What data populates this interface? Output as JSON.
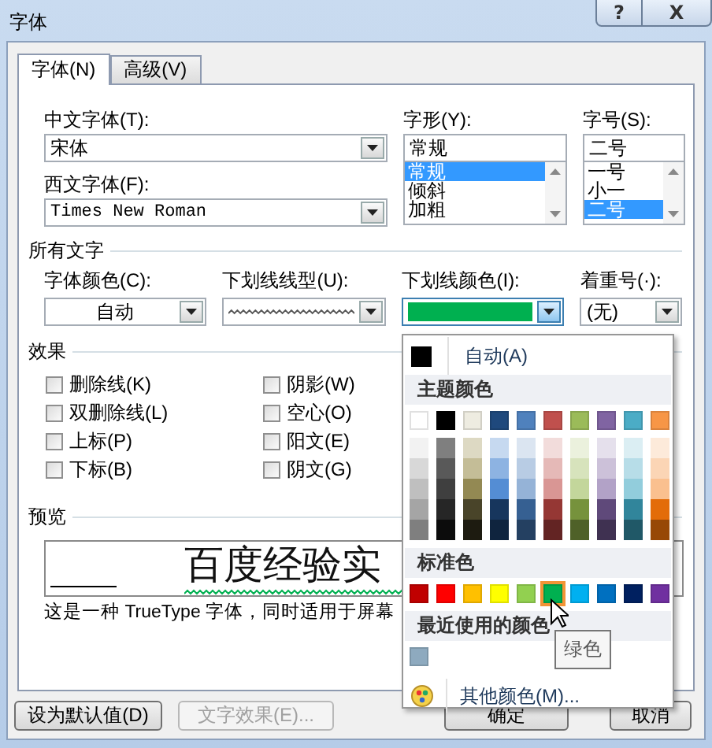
{
  "window": {
    "title": "字体",
    "help": "?",
    "close": "X"
  },
  "tabs": [
    {
      "label": "字体(N)",
      "selected": true
    },
    {
      "label": "高级(V)",
      "selected": false
    }
  ],
  "font": {
    "chinese_font": {
      "label": "中文字体(T):",
      "value": "宋体"
    },
    "western_font": {
      "label": "西文字体(F):",
      "value": "Times New Roman"
    },
    "style": {
      "label": "字形(Y):",
      "value": "常规",
      "items": [
        {
          "label": "常规",
          "selected": true
        },
        {
          "label": "倾斜",
          "selected": false
        },
        {
          "label": "加粗",
          "selected": false
        }
      ]
    },
    "size": {
      "label": "字号(S):",
      "value": "二号",
      "items": [
        {
          "label": "一号",
          "selected": false
        },
        {
          "label": "小一",
          "selected": false
        },
        {
          "label": "二号",
          "selected": true
        }
      ]
    }
  },
  "all_text": {
    "heading": "所有文字",
    "font_color": {
      "label": "字体颜色(C):",
      "value": "自动"
    },
    "underline_style": {
      "label": "下划线线型(U):"
    },
    "underline_color": {
      "label": "下划线颜色(I):",
      "color": "#00b050",
      "open": true
    },
    "emphasis": {
      "label": "着重号(·):",
      "value": "(无)"
    }
  },
  "effects": {
    "heading": "效果",
    "options": [
      {
        "label": "删除线(K)",
        "checked": false
      },
      {
        "label": "阴影(W)",
        "checked": false
      },
      {
        "label": "双删除线(L)",
        "checked": false
      },
      {
        "label": "空心(O)",
        "checked": false
      },
      {
        "label": "上标(P)",
        "checked": false
      },
      {
        "label": "阳文(E)",
        "checked": false
      },
      {
        "label": "下标(B)",
        "checked": false
      },
      {
        "label": "阴文(G)",
        "checked": false
      }
    ]
  },
  "preview": {
    "heading": "预览",
    "sample": "百度经验实",
    "description": "这是一种 TrueType 字体，同时适用于屏幕"
  },
  "buttons": [
    {
      "label": "设为默认值(D)",
      "disabled": false
    },
    {
      "label": "文字效果(E)...",
      "disabled": true
    },
    {
      "label": "确定",
      "disabled": false
    },
    {
      "label": "取消",
      "disabled": false
    }
  ],
  "color_menu": {
    "automatic": {
      "label": "自动(A)",
      "color": "#000000"
    },
    "theme_heading": "主题颜色",
    "theme_colors": [
      {
        "color": "#ffffff",
        "selected": false,
        "shades": [
          {
            "color": "#f2f2f2"
          },
          {
            "color": "#d8d8d8"
          },
          {
            "color": "#bfbfbf"
          },
          {
            "color": "#a5a5a5"
          },
          {
            "color": "#7f7f7f"
          }
        ]
      },
      {
        "color": "#000000",
        "selected": false,
        "shades": [
          {
            "color": "#7f7f7f"
          },
          {
            "color": "#595959"
          },
          {
            "color": "#3f3f3f"
          },
          {
            "color": "#262626"
          },
          {
            "color": "#0c0c0c"
          }
        ]
      },
      {
        "color": "#eeece1",
        "selected": false,
        "shades": [
          {
            "color": "#ddd9c3"
          },
          {
            "color": "#c4bd97"
          },
          {
            "color": "#938953"
          },
          {
            "color": "#494429"
          },
          {
            "color": "#1d1b10"
          }
        ]
      },
      {
        "color": "#1f497d",
        "selected": false,
        "shades": [
          {
            "color": "#c6d9f0"
          },
          {
            "color": "#8db3e2"
          },
          {
            "color": "#548dd4"
          },
          {
            "color": "#17365d"
          },
          {
            "color": "#0f243e"
          }
        ]
      },
      {
        "color": "#4f81bd",
        "selected": false,
        "shades": [
          {
            "color": "#dbe5f1"
          },
          {
            "color": "#b8cce4"
          },
          {
            "color": "#95b3d7"
          },
          {
            "color": "#366092"
          },
          {
            "color": "#244061"
          }
        ]
      },
      {
        "color": "#c0504d",
        "selected": false,
        "shades": [
          {
            "color": "#f2dcdb"
          },
          {
            "color": "#e5b9b7"
          },
          {
            "color": "#d99694"
          },
          {
            "color": "#953734"
          },
          {
            "color": "#632423"
          }
        ]
      },
      {
        "color": "#9bbb59",
        "selected": false,
        "shades": [
          {
            "color": "#ebf1dd"
          },
          {
            "color": "#d7e3bc"
          },
          {
            "color": "#c3d69b"
          },
          {
            "color": "#76923c"
          },
          {
            "color": "#4f6128"
          }
        ]
      },
      {
        "color": "#8064a2",
        "selected": false,
        "shades": [
          {
            "color": "#e5e0ec"
          },
          {
            "color": "#ccc1d9"
          },
          {
            "color": "#b2a2c7"
          },
          {
            "color": "#5f497a"
          },
          {
            "color": "#3f3151"
          }
        ]
      },
      {
        "color": "#4bacc6",
        "selected": false,
        "shades": [
          {
            "color": "#dbeef3"
          },
          {
            "color": "#b7dde8"
          },
          {
            "color": "#92cddc"
          },
          {
            "color": "#31859b"
          },
          {
            "color": "#205867"
          }
        ]
      },
      {
        "color": "#f79646",
        "selected": false,
        "shades": [
          {
            "color": "#fdeada"
          },
          {
            "color": "#fbd5b5"
          },
          {
            "color": "#fac08f"
          },
          {
            "color": "#e36c09"
          },
          {
            "color": "#974806"
          }
        ]
      }
    ],
    "standard_heading": "标准色",
    "standard_colors": [
      {
        "color": "#c00000",
        "selected": false
      },
      {
        "color": "#ff0000",
        "selected": false
      },
      {
        "color": "#ffc000",
        "selected": false
      },
      {
        "color": "#ffff00",
        "selected": false
      },
      {
        "color": "#92d050",
        "selected": false
      },
      {
        "color": "#00b050",
        "selected": true
      },
      {
        "color": "#00b0f0",
        "selected": false
      },
      {
        "color": "#0070c0",
        "selected": false
      },
      {
        "color": "#002060",
        "selected": false
      },
      {
        "color": "#7030a0",
        "selected": false
      }
    ],
    "recent_heading": "最近使用的颜色",
    "recent_colors": [
      {
        "color": "#8eaabf",
        "selected": false
      }
    ],
    "more": "其他颜色(M)...",
    "tooltip": "绿色"
  }
}
